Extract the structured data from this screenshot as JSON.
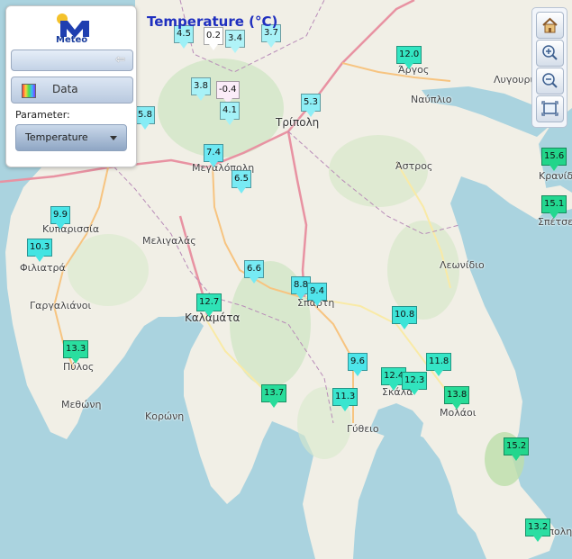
{
  "title": "Temperature (°C)",
  "logo": {
    "text": "Meteo",
    "colors": {
      "dot": "#f4c22b",
      "mark": "#1f3fb0"
    }
  },
  "panel": {
    "data_button_label": "Data",
    "parameter_label": "Parameter:",
    "parameter_selected": "Temperature"
  },
  "toolbar": {
    "icons": [
      "home-icon",
      "zoom-in-icon",
      "zoom-out-icon",
      "full-extent-icon"
    ]
  },
  "places": [
    {
      "label": "Άργος"
    },
    {
      "label": "Ναύπλιο"
    },
    {
      "label": "Λυγουριό"
    },
    {
      "label": "Τρίπολη"
    },
    {
      "label": "Μεγαλόπολη"
    },
    {
      "label": "Άστρος"
    },
    {
      "label": "Κρανίδι"
    },
    {
      "label": "Σπέτσες"
    },
    {
      "label": "Κυπαρισσία"
    },
    {
      "label": "Μελιγαλάς"
    },
    {
      "label": "Φιλιατρά"
    },
    {
      "label": "Λεωνίδιο"
    },
    {
      "label": "Γαργαλιάνοι"
    },
    {
      "label": "Καλαμάτα"
    },
    {
      "label": "Σπάρτη"
    },
    {
      "label": "Πύλος"
    },
    {
      "label": "Σκάλα"
    },
    {
      "label": "Μεθώνη"
    },
    {
      "label": "Κορώνη"
    },
    {
      "label": "Μολάοι"
    },
    {
      "label": "Γύθειο"
    },
    {
      "label": "Νεάπολη"
    }
  ],
  "stations": [
    {
      "value": "4.5",
      "color": "#9ef0f6"
    },
    {
      "value": "0.2",
      "color": "#ffffff"
    },
    {
      "value": "3.4",
      "color": "#b0f3f8"
    },
    {
      "value": "3.7",
      "color": "#a8f2f7"
    },
    {
      "value": "12.0",
      "color": "#33e5c2"
    },
    {
      "value": "3.8",
      "color": "#a8f2f7"
    },
    {
      "value": "-0.4",
      "color": "#fbecf8"
    },
    {
      "value": "4.1",
      "color": "#a4f1f7"
    },
    {
      "value": "5.3",
      "color": "#8deef6"
    },
    {
      "value": "5.8",
      "color": "#86ecf5"
    },
    {
      "value": "7.4",
      "color": "#6ce8f3"
    },
    {
      "value": "6.5",
      "color": "#78eaf4"
    },
    {
      "value": "15.6",
      "color": "#22d58a"
    },
    {
      "value": "15.1",
      "color": "#23d790"
    },
    {
      "value": "9.9",
      "color": "#4ae5e8"
    },
    {
      "value": "10.3",
      "color": "#42e4e2"
    },
    {
      "value": "6.6",
      "color": "#76eaf4"
    },
    {
      "value": "8.8",
      "color": "#5ae6ef"
    },
    {
      "value": "9.4",
      "color": "#50e5eb"
    },
    {
      "value": "12.7",
      "color": "#2ee2b6"
    },
    {
      "value": "10.8",
      "color": "#3de4d8"
    },
    {
      "value": "13.3",
      "color": "#2ade9f"
    },
    {
      "value": "9.6",
      "color": "#4de5ea"
    },
    {
      "value": "11.8",
      "color": "#35e5c6"
    },
    {
      "value": "12.4",
      "color": "#30e3bc"
    },
    {
      "value": "12.3",
      "color": "#31e4be"
    },
    {
      "value": "13.7",
      "color": "#28dc9a"
    },
    {
      "value": "11.3",
      "color": "#39e5cf"
    },
    {
      "value": "13.8",
      "color": "#28dc98"
    },
    {
      "value": "15.2",
      "color": "#23d68d"
    },
    {
      "value": "13.2",
      "color": "#2bdea2"
    }
  ]
}
